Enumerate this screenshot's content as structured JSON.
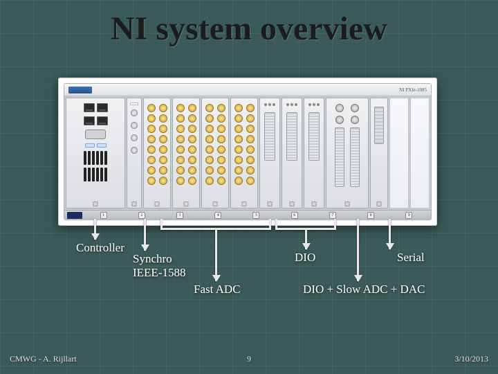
{
  "title": "NI system overview",
  "chassis_model": "NI PXIe-1085",
  "labels": {
    "controller": "Controller",
    "synchro": "Synchro\nIEEE-1588",
    "fast_adc": "Fast ADC",
    "dio": "DIO",
    "dio_slow": "DIO + Slow ADC + DAC",
    "serial": "Serial"
  },
  "footer": {
    "left": "CMWG - A. Rijllart",
    "page": "9",
    "date": "3/10/2013"
  },
  "colors": {
    "bg": "#3a5a58",
    "arrow": "#e8e8e8"
  }
}
